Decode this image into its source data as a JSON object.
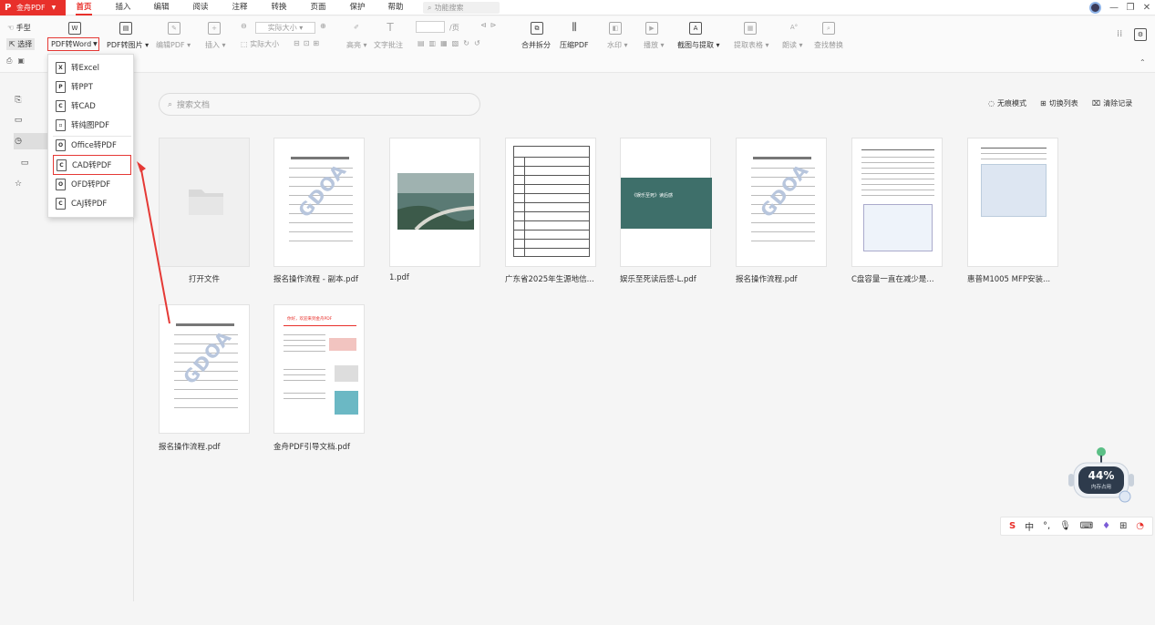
{
  "app": {
    "name": "金舟PDF"
  },
  "menu_tabs": [
    "首页",
    "插入",
    "编辑",
    "阅读",
    "注释",
    "转换",
    "页面",
    "保护",
    "帮助"
  ],
  "feature_search_placeholder": "功能搜索",
  "toolbar": {
    "hand": "手型",
    "select": "选择",
    "pdf_to_word": "PDF转Word",
    "pdf_to_image": "PDF转图片",
    "edit_pdf": "编辑PDF",
    "insert": "插入",
    "zoom_value": "实际大小",
    "actual_size": "实际大小",
    "highlight": "高亮",
    "text_note": "文字批注",
    "page_suffix": "/页",
    "merge_split": "合并拆分",
    "compress": "压缩PDF",
    "watermark": "水印",
    "play": "播放",
    "screenshot_extract": "截图与提取",
    "extract_table": "提取表格",
    "read_aloud": "朗读",
    "find_replace": "查找替换"
  },
  "dropdown": [
    "转Excel",
    "转PPT",
    "转CAD",
    "转纯图PDF",
    "Office转PDF",
    "CAD转PDF",
    "OFD转PDF",
    "CAJ转PDF"
  ],
  "search_placeholder": "搜索文档",
  "top_actions": {
    "no_trace": "无痕模式",
    "switch_list": "切换列表",
    "clear_history": "清除记录"
  },
  "files": [
    {
      "name": "打开文件"
    },
    {
      "name": "报名操作流程 - 副本.pdf"
    },
    {
      "name": "1.pdf"
    },
    {
      "name": "广东省2025年生源地信..."
    },
    {
      "name": "娱乐至死读后感-L.pdf"
    },
    {
      "name": "报名操作流程.pdf"
    },
    {
      "name": "C盘容量一直在减少是..."
    },
    {
      "name": "惠普M1005 MFP安装..."
    },
    {
      "name": "报名操作流程.pdf"
    },
    {
      "name": "金舟PDF引导文档.pdf"
    }
  ],
  "doc_preview": {
    "watermark_text": "GDOA",
    "cover_text": "《娱乐至死》读后感",
    "guide_title": "你好，欢迎来到金舟PDF"
  },
  "assistant": {
    "percent": "44%",
    "label": "内存占用"
  },
  "ime": {
    "lang": "中"
  },
  "colors": {
    "brand": "#e8302b",
    "highlight_border": "#e53935"
  }
}
